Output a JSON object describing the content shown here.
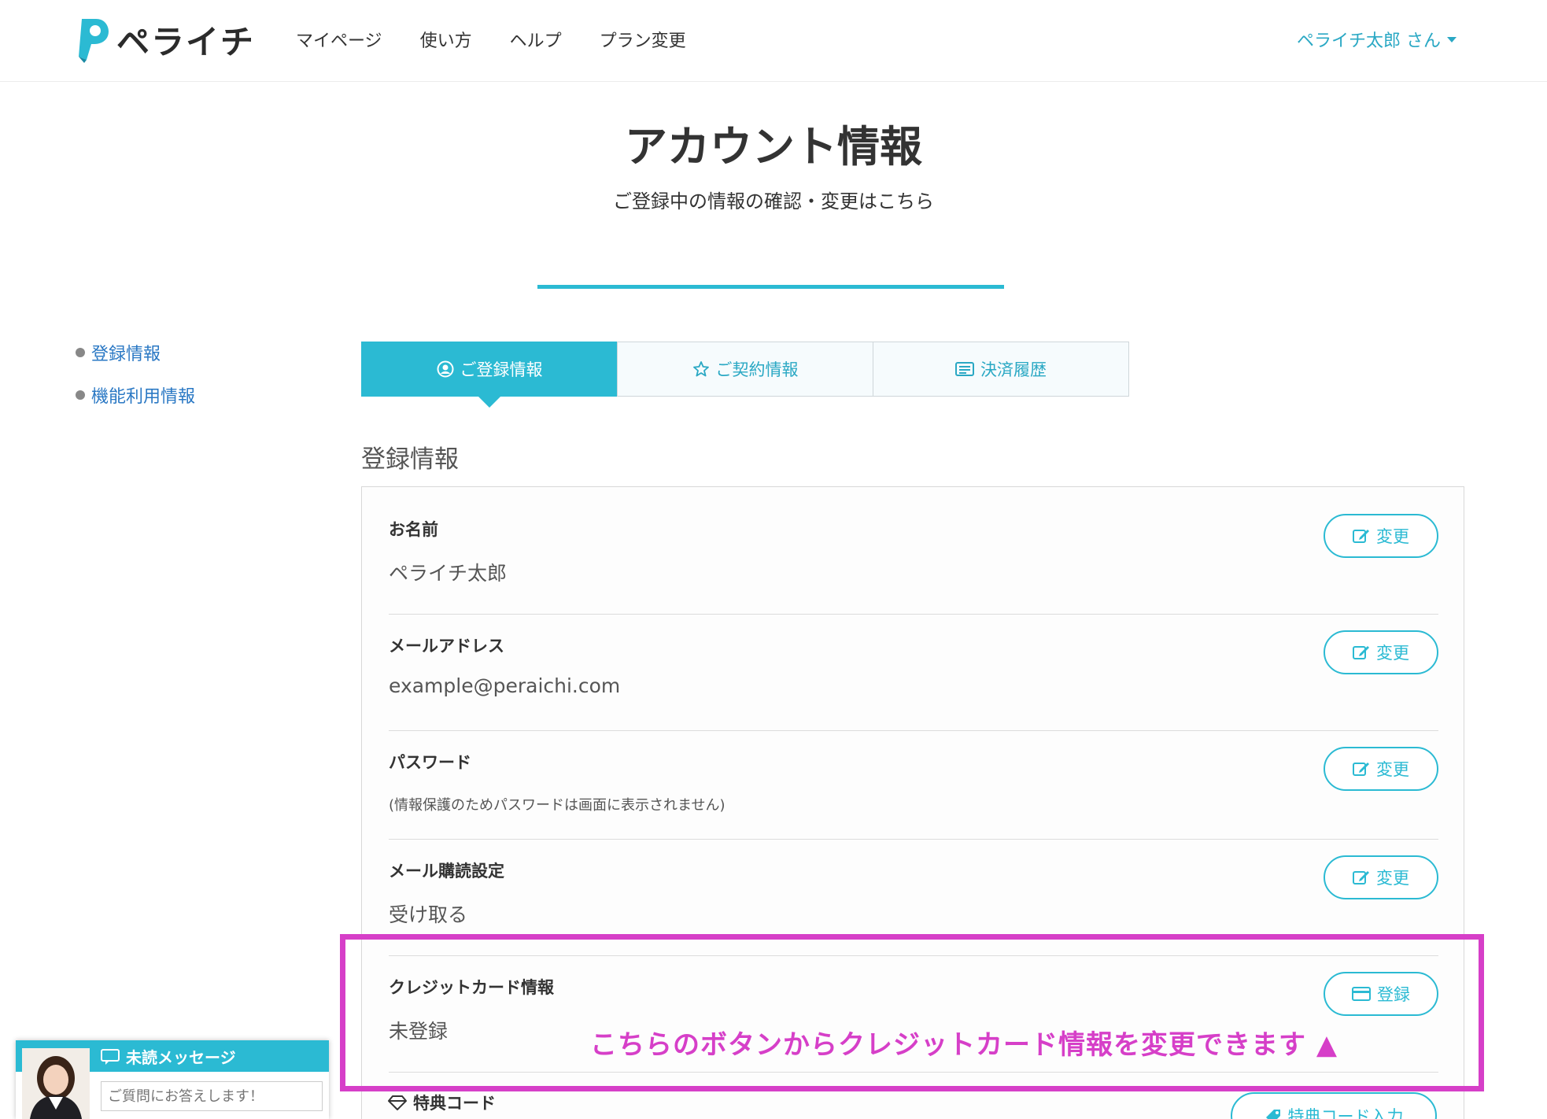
{
  "header": {
    "logo_text": "ペライチ",
    "nav": [
      "マイページ",
      "使い方",
      "ヘルプ",
      "プラン変更"
    ],
    "user": "ペライチ太郎 さん"
  },
  "page": {
    "title": "アカウント情報",
    "subtitle": "ご登録中の情報の確認・変更はこちら"
  },
  "side_nav": [
    "登録情報",
    "機能利用情報"
  ],
  "tabs": [
    {
      "label": "ご登録情報",
      "icon": "user-circle-icon"
    },
    {
      "label": "ご契約情報",
      "icon": "star-icon"
    },
    {
      "label": "決済履歴",
      "icon": "receipt-icon"
    }
  ],
  "section_heading": "登録情報",
  "rows": {
    "name": {
      "label": "お名前",
      "value": "ペライチ太郎",
      "button": "変更"
    },
    "email": {
      "label": "メールアドレス",
      "value": "example@peraichi.com",
      "button": "変更"
    },
    "password": {
      "label": "パスワード",
      "note": "(情報保護のためパスワードは画面に表示されません)",
      "button": "変更"
    },
    "mail_subscription": {
      "label": "メール購読設定",
      "value": "受け取る",
      "button": "変更"
    },
    "credit_card": {
      "label": "クレジットカード情報",
      "value": "未登録",
      "button": "登録"
    },
    "coupon": {
      "label": "特典コード",
      "button": "特典コード入力"
    }
  },
  "annotation": "こちらのボタンからクレジットカード情報を変更できます ▲",
  "chat": {
    "title": "未読メッセージ",
    "placeholder": "ご質問にお答えします！"
  },
  "colors": {
    "accent": "#2bbad3",
    "link": "#2a78c4",
    "highlight": "#d63fc8"
  }
}
